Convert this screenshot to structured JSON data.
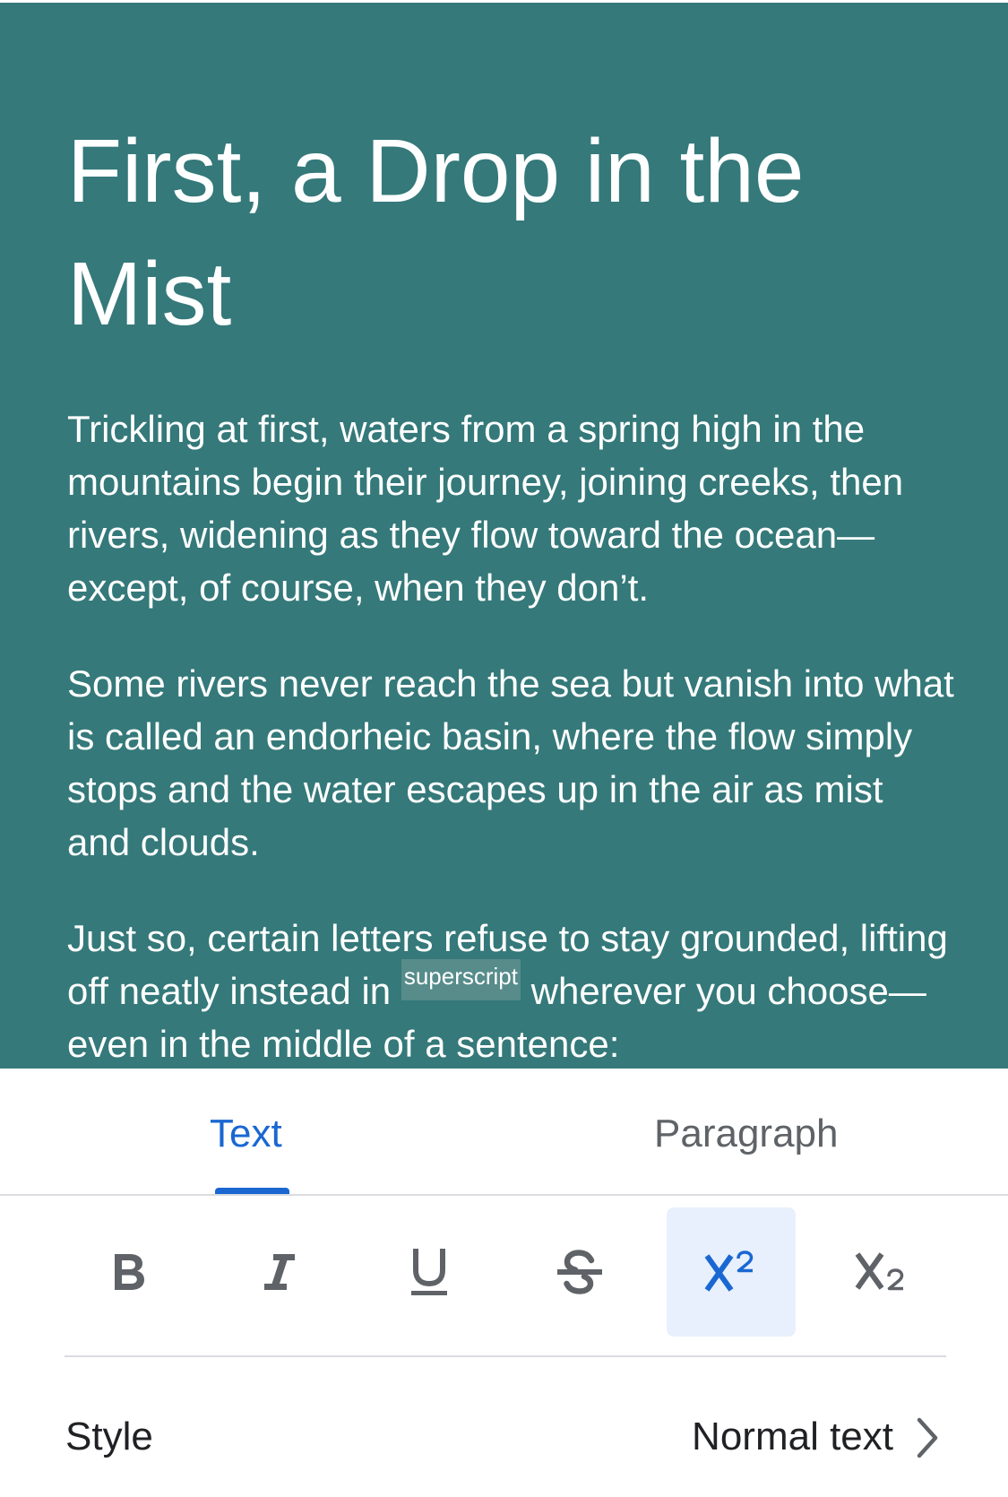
{
  "document": {
    "title": "First, a Drop in the Mist",
    "paragraph1": "Trickling at first, waters from a spring high in the mountains begin their journey, joining creeks, then rivers, widening as they flow toward the ocean—except, of course, when they don’t.",
    "paragraph2": "Some rivers never reach the sea but vanish into what is called an endorheic basin, where the flow simply stops and the water escapes up in the air as mist and clouds.",
    "paragraph3": {
      "before": "Just so, certain letters refuse to stay grounded, lifting off neatly instead in ",
      "superscript_word": "superscript",
      "after": " wherever you choose—even in the middle of a sentence:"
    }
  },
  "format_panel": {
    "tabs": [
      {
        "label": "Text",
        "active": true
      },
      {
        "label": "Paragraph",
        "active": false
      }
    ],
    "buttons": [
      {
        "icon": "bold-icon",
        "active": false
      },
      {
        "icon": "italic-icon",
        "active": false
      },
      {
        "icon": "underline-icon",
        "active": false
      },
      {
        "icon": "strikethrough-icon",
        "active": false
      },
      {
        "icon": "superscript-icon",
        "active": true
      },
      {
        "icon": "subscript-icon",
        "active": false
      }
    ],
    "style": {
      "label": "Style",
      "value": "Normal text"
    }
  },
  "colors": {
    "document_background": "#35797a",
    "accent": "#1a67d2",
    "active_button_background": "#e8f0fe",
    "icon_gray": "#5f6368"
  }
}
